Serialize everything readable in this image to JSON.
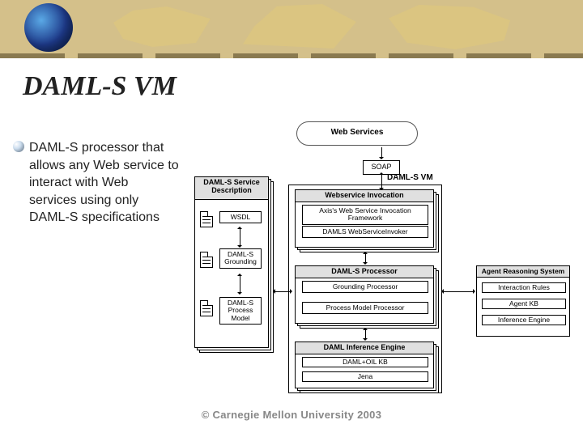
{
  "title": "DAML-S VM",
  "body_text": "DAML-S processor that allows any Web service to interact with Web services using only DAML-S specifications",
  "copyright": "© Carnegie Mellon University 2003",
  "diagram": {
    "cloud": "Web Services",
    "soap": "SOAP",
    "vm_label": "DAML-S VM",
    "service_desc": {
      "title": "DAML-S Service Description",
      "items": [
        "WSDL",
        "DAML-S Grounding",
        "DAML-S Process Model"
      ]
    },
    "invocation": {
      "title": "Webservice Invocation",
      "items": [
        "Axis's Web Service Invocation Framework",
        "DAMLS WebServiceInvoker"
      ]
    },
    "processor": {
      "title": "DAML-S Processor",
      "items": [
        "Grounding Processor",
        "Process Model Processor"
      ]
    },
    "inference": {
      "title": "DAML Inference Engine",
      "items": [
        "DAML+OIL KB",
        "Jena"
      ]
    },
    "agent": {
      "title": "Agent Reasoning System",
      "items": [
        "Interaction Rules",
        "Agent KB",
        "Inference Engine"
      ]
    }
  }
}
